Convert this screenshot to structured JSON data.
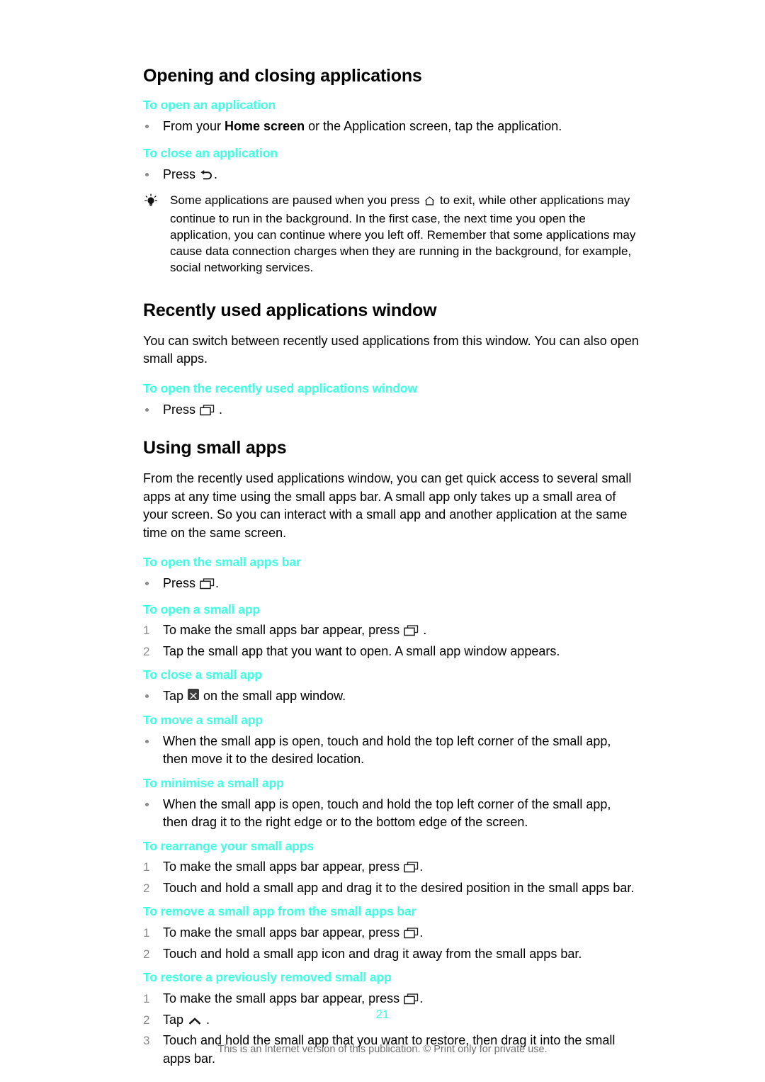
{
  "page": {
    "number": "21",
    "footer_note": "This is an Internet version of this publication. © Print only for private use.",
    "accent_color": "#3DFFE2",
    "text_color": "#000000",
    "muted_color": "#8b8b8b"
  },
  "sections": {
    "opening_closing": {
      "title": "Opening and closing applications",
      "open_app": {
        "heading": "To open an application",
        "step_before": "From your ",
        "step_bold": "Home screen",
        "step_after": " or the Application screen, tap the application."
      },
      "close_app": {
        "heading": "To close an application",
        "step_before": "Press ",
        "step_icon": "back-arrow-icon",
        "step_after": "."
      },
      "tip": {
        "icon": "lightbulb-tip-icon",
        "text_before": "Some applications are paused when you press ",
        "text_icon": "home-icon",
        "text_after": " to exit, while other applications may continue to run in the background. In the first case, the next time you open the application, you can continue where you left off. Remember that some applications may cause data connection charges when they are running in the background, for example, social networking services."
      }
    },
    "recently_used": {
      "title": "Recently used applications window",
      "intro": "You can switch between recently used applications from this window. You can also open small apps.",
      "open_window": {
        "heading": "To open the recently used applications window",
        "step_before": "Press ",
        "step_icon": "recent-apps-icon",
        "step_after": " ."
      }
    },
    "using_small_apps": {
      "title": "Using small apps",
      "intro": "From the recently used applications window, you can get quick access to several small apps at any time using the small apps bar. A small app only takes up a small area of your screen. So you can interact with a small app and another application at the same time on the same screen.",
      "open_bar": {
        "heading": "To open the small apps bar",
        "step_before": "Press ",
        "step_icon": "recent-apps-icon",
        "step_after": "."
      },
      "open_small_app": {
        "heading": "To open a small app",
        "steps": [
          {
            "number": "1",
            "text_before": "To make the small apps bar appear, press ",
            "icon": "recent-apps-icon",
            "text_after": " ."
          },
          {
            "number": "2",
            "text_before": "Tap the small app that you want to open. A small app window appears.",
            "icon": "",
            "text_after": ""
          }
        ]
      },
      "close_small_app": {
        "heading": "To close a small app",
        "step_before": "Tap ",
        "step_icon": "close-x-icon",
        "step_after": " on the small app window."
      },
      "move_small_app": {
        "heading": "To move a small app",
        "step": "When the small app is open, touch and hold the top left corner of the small app, then move it to the desired location."
      },
      "minimise_small_app": {
        "heading": "To minimise a small app",
        "step": "When the small app is open, touch and hold the top left corner of the small app, then drag it to the right edge or to the bottom edge of the screen."
      },
      "rearrange_small_apps": {
        "heading": "To rearrange your small apps",
        "steps": [
          {
            "number": "1",
            "text_before": "To make the small apps bar appear, press ",
            "icon": "recent-apps-icon",
            "text_after": "."
          },
          {
            "number": "2",
            "text_before": "Touch and hold a small app and drag it to the desired position in the small apps bar.",
            "icon": "",
            "text_after": ""
          }
        ]
      },
      "remove_small_app": {
        "heading": "To remove a small app from the small apps bar",
        "steps": [
          {
            "number": "1",
            "text_before": "To make the small apps bar appear, press ",
            "icon": "recent-apps-icon",
            "text_after": "."
          },
          {
            "number": "2",
            "text_before": "Touch and hold a small app icon and drag it away from the small apps bar.",
            "icon": "",
            "text_after": ""
          }
        ]
      },
      "restore_small_app": {
        "heading": "To restore a previously removed small app",
        "steps": [
          {
            "number": "1",
            "text_before": "To make the small apps bar appear, press ",
            "icon": "recent-apps-icon",
            "text_after": "."
          },
          {
            "number": "2",
            "text_before": "Tap ",
            "icon": "chevron-up-icon",
            "text_after": " ."
          },
          {
            "number": "3",
            "text_before": "Touch and hold the small app that you want to restore, then drag it into the small apps bar.",
            "icon": "",
            "text_after": ""
          }
        ]
      }
    }
  }
}
